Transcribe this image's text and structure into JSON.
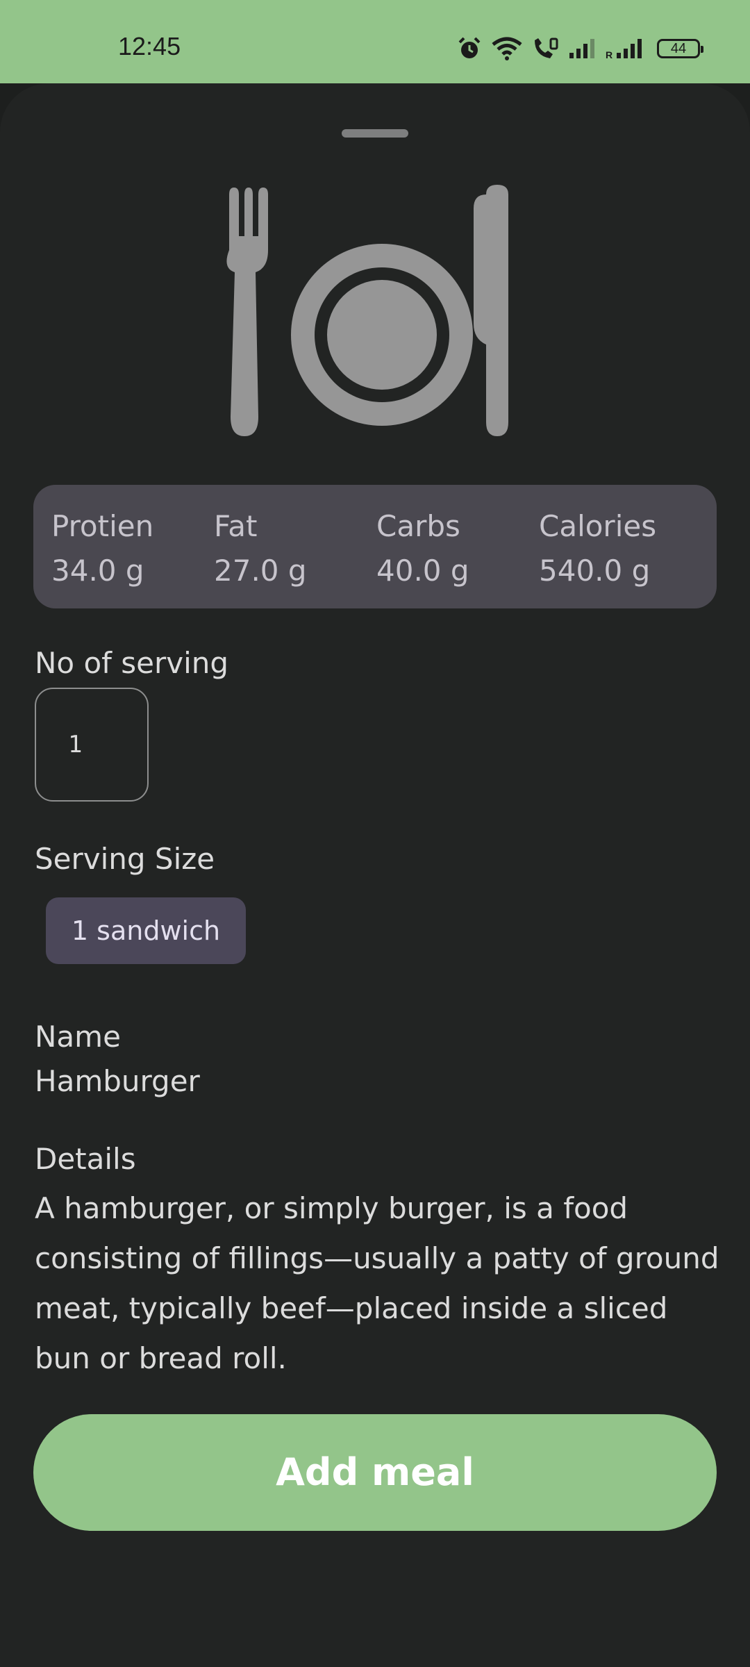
{
  "status_bar": {
    "time": "12:45",
    "battery": "44",
    "background_color": "#93c58a",
    "icons": [
      "alarm-icon",
      "wifi-icon",
      "wifi-calling-icon",
      "signal-icon",
      "signal-roaming-icon",
      "battery-icon"
    ]
  },
  "macros": {
    "protein_label": "Protien",
    "protein_value": "34.0 g",
    "fat_label": "Fat",
    "fat_value": "27.0 g",
    "carbs_label": "Carbs",
    "carbs_value": "40.0 g",
    "calories_label": "Calories",
    "calories_value": "540.0 g"
  },
  "serving": {
    "count_label": "No of serving",
    "count_value": "1",
    "size_label": "Serving Size",
    "size_chip": "1 sandwich"
  },
  "food": {
    "name_label": "Name",
    "name_value": "Hamburger",
    "details_label": "Details",
    "details_value": "A hamburger, or simply burger, is a food consisting of fillings—usually a patty of ground meat, typically beef—placed inside a sliced bun or bread roll."
  },
  "actions": {
    "add_label": "Add meal"
  },
  "theme": {
    "accent": "#93c58a",
    "sheet_background": "#222423",
    "card_background": "#4a4850",
    "chip_background": "#4b4759"
  },
  "meal_icon": "fork-plate-knife-icon"
}
